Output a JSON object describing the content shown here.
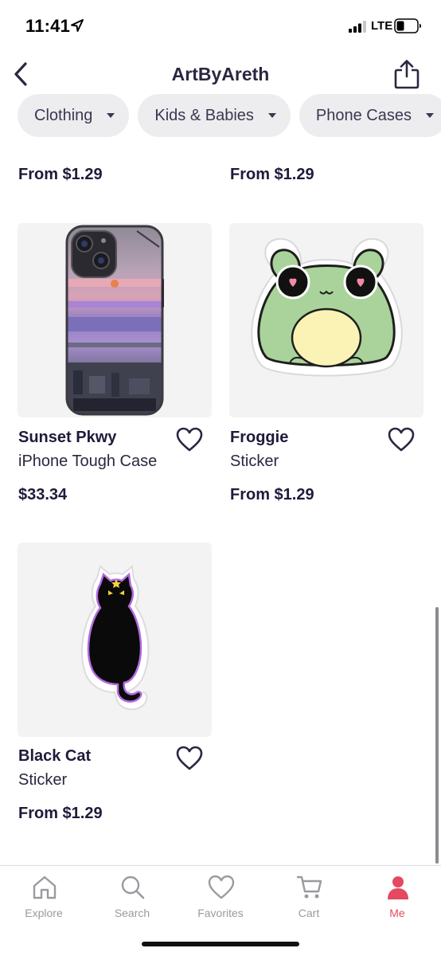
{
  "status_bar": {
    "time": "11:41",
    "network": "LTE"
  },
  "header": {
    "title": "ArtByAreth"
  },
  "chips": [
    {
      "label": "Clothing"
    },
    {
      "label": "Kids & Babies"
    },
    {
      "label": "Phone Cases"
    }
  ],
  "partial_row": {
    "left_price": "From $1.29",
    "right_price": "From $1.29"
  },
  "products": [
    {
      "title": "Sunset Pkwy",
      "subtitle": "iPhone Tough Case",
      "price": "$33.34",
      "image": "sunset-phone-case"
    },
    {
      "title": "Froggie",
      "subtitle": "Sticker",
      "price": "From $1.29",
      "image": "frog-sticker"
    },
    {
      "title": "Black Cat",
      "subtitle": "Sticker",
      "price": "From $1.29",
      "image": "black-cat-sticker"
    }
  ],
  "tabbar": {
    "items": [
      {
        "label": "Explore",
        "icon": "home-icon"
      },
      {
        "label": "Search",
        "icon": "search-icon"
      },
      {
        "label": "Favorites",
        "icon": "heart-icon"
      },
      {
        "label": "Cart",
        "icon": "cart-icon"
      },
      {
        "label": "Me",
        "icon": "person-icon"
      }
    ],
    "active": "Me"
  },
  "colors": {
    "accent": "#e5495f",
    "text": "#1e1b3a",
    "chip_bg": "#ededf0",
    "card_bg": "#f3f3f4"
  }
}
